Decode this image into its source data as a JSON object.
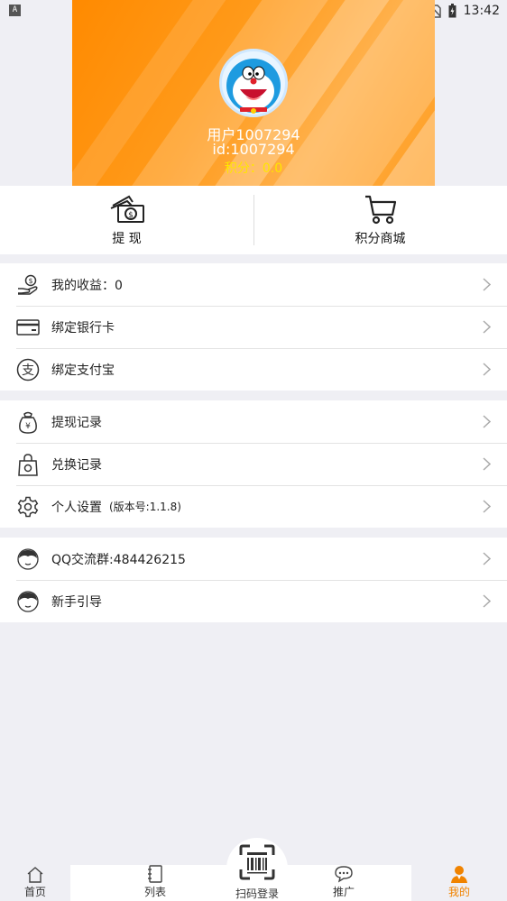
{
  "status_bar": {
    "time": "13:42",
    "indicator": "A"
  },
  "profile": {
    "name": "用户1007294",
    "id": "id:1007294",
    "points": "积分：0.0"
  },
  "quick_actions": [
    {
      "label": "提 现",
      "icon": "cash-icon"
    },
    {
      "label": "积分商城",
      "icon": "cart-icon"
    }
  ],
  "menu": {
    "group1": [
      {
        "label": "我的收益：0",
        "icon": "income-icon"
      },
      {
        "label": "绑定银行卡",
        "icon": "bank-card-icon"
      },
      {
        "label": "绑定支付宝",
        "icon": "alipay-icon"
      }
    ],
    "group2": [
      {
        "label": "提现记录",
        "icon": "withdraw-record-icon"
      },
      {
        "label": "兑换记录",
        "icon": "exchange-record-icon"
      },
      {
        "label": "个人设置",
        "sub": "(版本号:1.1.8)",
        "icon": "settings-icon"
      }
    ],
    "group3": [
      {
        "label": "QQ交流群:484426215",
        "icon": "person-icon"
      },
      {
        "label": "新手引导",
        "icon": "person-icon"
      }
    ]
  },
  "tabbar": [
    {
      "label": "首页",
      "icon": "home-icon"
    },
    {
      "label": "列表",
      "icon": "list-icon"
    },
    {
      "label": "扫码登录",
      "icon": "scan-icon"
    },
    {
      "label": "推广",
      "icon": "chat-icon"
    },
    {
      "label": "我的",
      "icon": "user-icon",
      "active": true
    }
  ],
  "colors": {
    "accent": "#f08300",
    "points": "#ffe600",
    "background": "#efeff4"
  }
}
